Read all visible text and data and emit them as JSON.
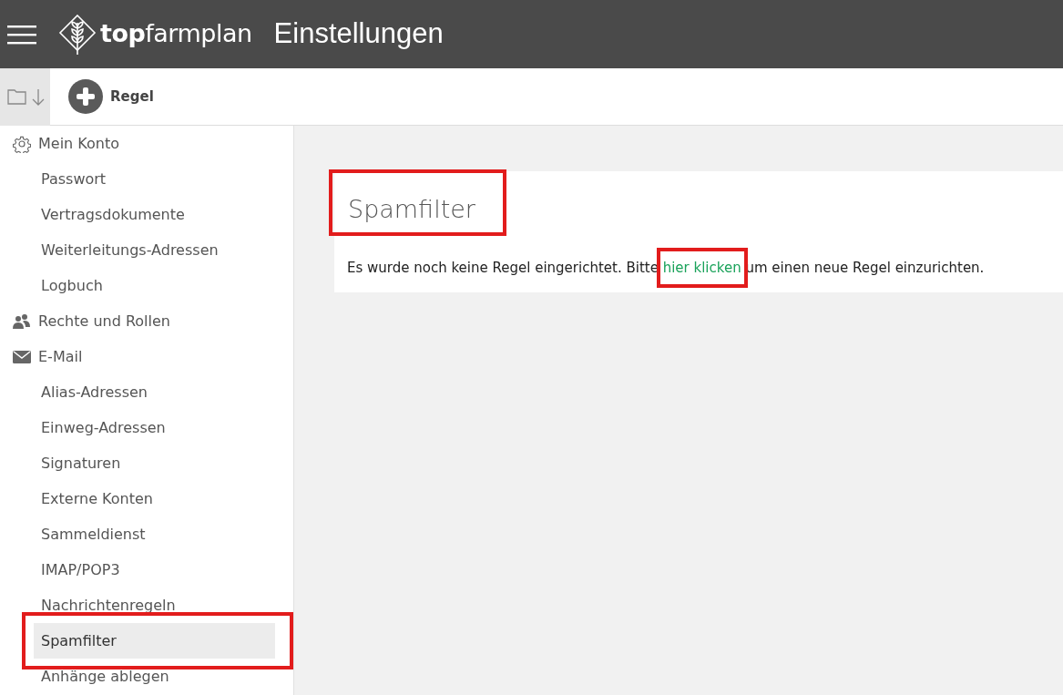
{
  "header": {
    "brand_bold": "top",
    "brand_light": "farmplan",
    "title": "Einstellungen"
  },
  "toolbar": {
    "add_button": "Regel"
  },
  "sidebar": {
    "sections": [
      {
        "label": "Mein Konto",
        "kind": "settings",
        "children": [
          {
            "label": "Passwort",
            "selected": false,
            "highlighted": false
          },
          {
            "label": "Vertragsdokumente",
            "selected": false,
            "highlighted": false
          },
          {
            "label": "Weiterleitungs-Adressen",
            "selected": false,
            "highlighted": false
          },
          {
            "label": "Logbuch",
            "selected": false,
            "highlighted": false
          }
        ]
      },
      {
        "label": "Rechte und Rollen",
        "kind": "people"
      },
      {
        "label": "E-Mail",
        "kind": "mail",
        "children": [
          {
            "label": "Alias-Adressen",
            "selected": false,
            "highlighted": false
          },
          {
            "label": "Einweg-Adressen",
            "selected": false,
            "highlighted": false
          },
          {
            "label": "Signaturen",
            "selected": false,
            "highlighted": false
          },
          {
            "label": "Externe Konten",
            "selected": false,
            "highlighted": false
          },
          {
            "label": "Sammeldienst",
            "selected": false,
            "highlighted": false
          },
          {
            "label": "IMAP/POP3",
            "selected": false,
            "highlighted": false
          },
          {
            "label": "Nachrichtenregeln",
            "selected": false,
            "highlighted": false
          },
          {
            "label": "Spamfilter",
            "selected": true,
            "highlighted": true
          },
          {
            "label": "Anhänge ablegen",
            "selected": false,
            "highlighted": false
          }
        ]
      }
    ]
  },
  "panel": {
    "title": "Spamfilter",
    "title_highlighted": true,
    "message_before": "Es wurde noch keine Regel eingerichtet. Bitte",
    "link": "hier klicken",
    "link_highlighted": true,
    "message_after": "um einen neue Regel einzurichten."
  }
}
